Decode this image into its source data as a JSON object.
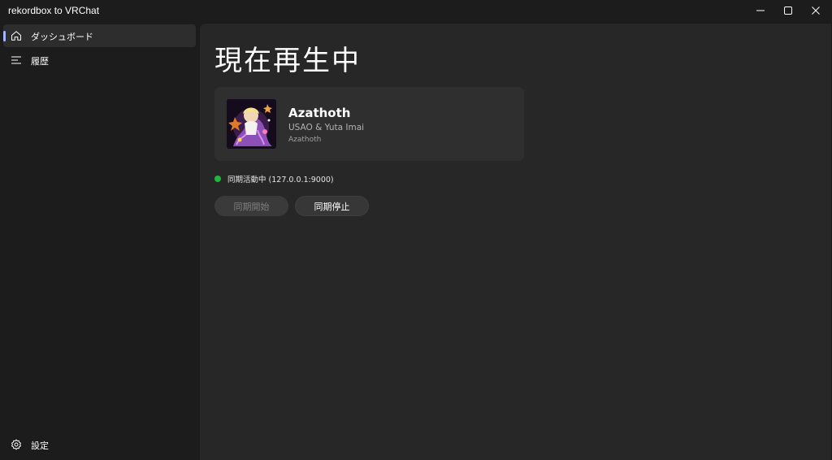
{
  "window": {
    "title": "rekordbox to VRChat"
  },
  "sidebar": {
    "items": [
      {
        "label": "ダッシュボード",
        "icon": "home-icon",
        "active": true
      },
      {
        "label": "履歴",
        "icon": "list-icon",
        "active": false
      }
    ],
    "footer": {
      "label": "設定",
      "icon": "gear-icon"
    }
  },
  "main": {
    "title": "現在再生中",
    "track": {
      "title": "Azathoth",
      "artist": "USAO & Yuta Imai",
      "album": "Azathoth"
    },
    "status": {
      "text": "同期活動中 (127.0.0.1:9000)",
      "color": "#1db83c"
    },
    "buttons": {
      "start_label": "同期開始",
      "stop_label": "同期停止"
    }
  },
  "colors": {
    "accent": "#a7b6ff",
    "background": "#1c1c1c",
    "content_background": "#272727"
  }
}
